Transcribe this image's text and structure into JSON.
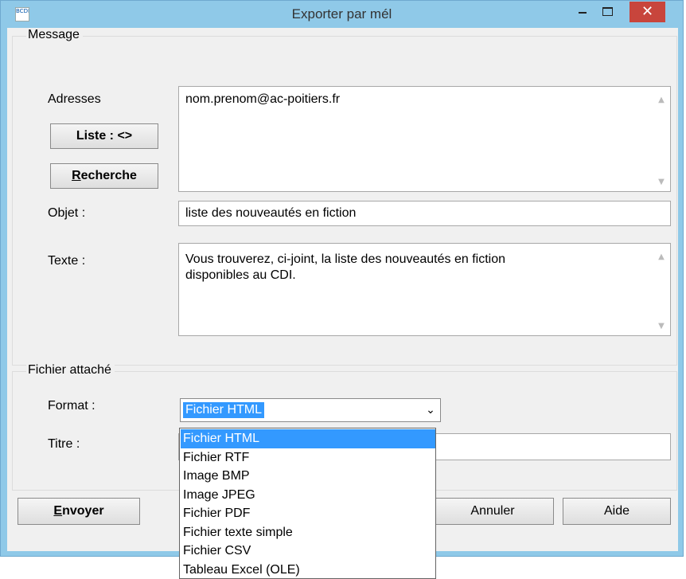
{
  "window": {
    "title": "Exporter par mél",
    "app_icon_text": "BCDI",
    "minimize_glyph": "–",
    "close_glyph": "✕"
  },
  "message": {
    "legend": "Message",
    "adresses_label": "Adresses",
    "adresses_value": "nom.prenom@ac-poitiers.fr",
    "liste_button": "Liste : <>",
    "recherche_button_first": "R",
    "recherche_button_rest": "echerche",
    "objet_label": "Objet :",
    "objet_value": "liste des nouveautés en fiction",
    "texte_label": "Texte :",
    "texte_value": "Vous trouverez, ci-joint, la liste des nouveautés en fiction\ndisponibles au CDI."
  },
  "attachment": {
    "legend": "Fichier attaché",
    "format_label": "Format :",
    "format_selected": "Fichier HTML",
    "titre_label": "Titre :",
    "titre_value": "",
    "format_options": [
      "Fichier HTML",
      "Fichier RTF",
      "Image BMP",
      "Image JPEG",
      "Fichier PDF",
      "Fichier texte simple",
      "Fichier CSV",
      "Tableau Excel (OLE)"
    ],
    "selected_index": 0
  },
  "footer": {
    "envoyer_first": "E",
    "envoyer_rest": "nvoyer",
    "annuler": "Annuler",
    "aide": "Aide"
  },
  "colors": {
    "title_bar": "#8fc9e8",
    "close_button": "#c8453c",
    "selection": "#3399ff",
    "dialog_background": "#f0f0f0"
  }
}
